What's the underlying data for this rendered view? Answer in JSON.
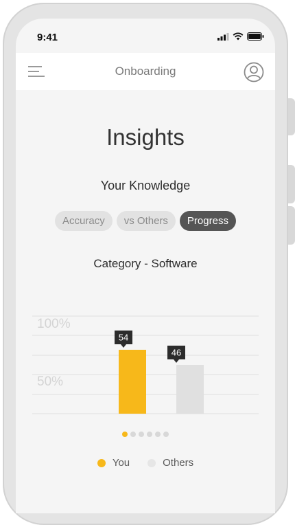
{
  "status_bar": {
    "time": "9:41"
  },
  "nav": {
    "title": "Onboarding"
  },
  "page": {
    "heading": "Insights",
    "subheading": "Your Knowledge"
  },
  "tabs": [
    {
      "label": "Accuracy",
      "active": false
    },
    {
      "label": "vs Others",
      "active": false
    },
    {
      "label": "Progress",
      "active": true
    }
  ],
  "chart_data": {
    "type": "bar",
    "title": "Category - Software",
    "y_tick_labels": [
      "100%",
      "50%"
    ],
    "ylim": [
      0,
      100
    ],
    "grid": true,
    "series": [
      {
        "name": "You",
        "value": 54,
        "label": "54",
        "color": "#f7b81a"
      },
      {
        "name": "Others",
        "value": 46,
        "label": "46",
        "color": "#e0e0e0"
      }
    ]
  },
  "pager": {
    "count": 6,
    "active_index": 0
  },
  "legend": [
    {
      "label": "You",
      "color": "#f7b81a"
    },
    {
      "label": "Others",
      "color": "#e6e6e6"
    }
  ],
  "colors": {
    "accent": "#f7b81a",
    "active_tab": "#555555"
  }
}
